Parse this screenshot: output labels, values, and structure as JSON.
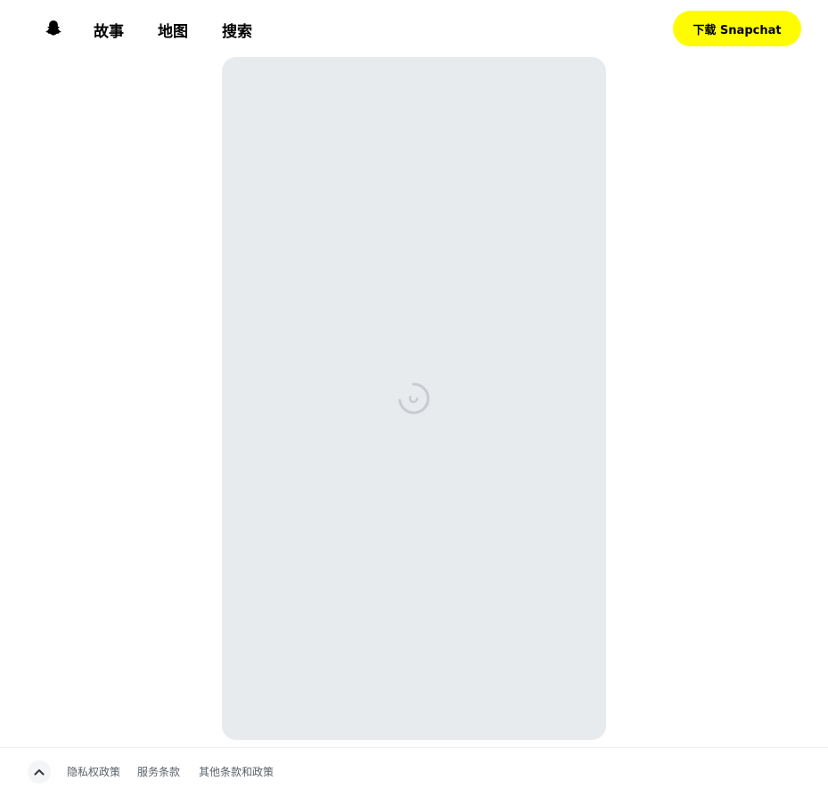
{
  "header": {
    "logo_icon": "snapchat-ghost-icon",
    "nav": {
      "stories": "故事",
      "map": "地图",
      "search": "搜索"
    },
    "download_label": "下载 Snapchat",
    "download_color": "#FFFC00"
  },
  "main": {
    "card_color": "#E8EBEE",
    "loading_icon": "loading-spinner-icon"
  },
  "footer": {
    "collapse_icon": "chevron-up-icon",
    "links": {
      "privacy": "隐私权政策",
      "terms": "服务条款",
      "other": "其他条款和政策"
    }
  }
}
